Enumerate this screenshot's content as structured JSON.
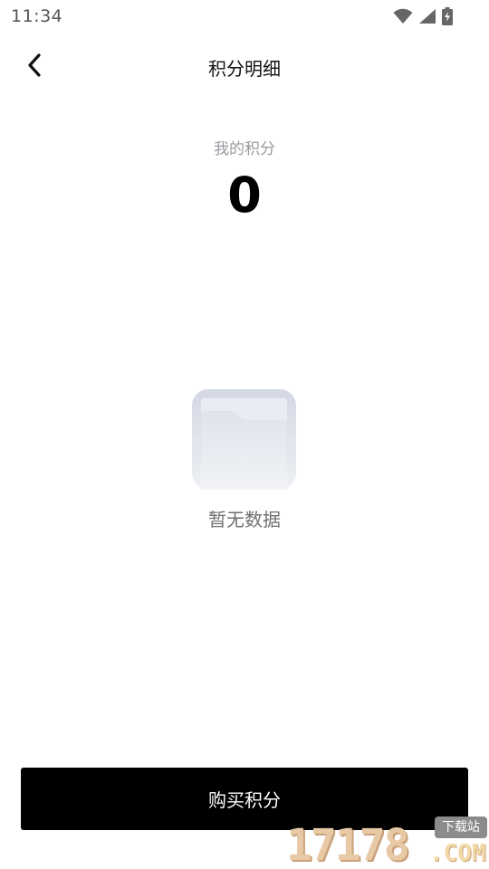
{
  "status_bar": {
    "time": "11:34",
    "icons": [
      "wifi-icon",
      "signal-icon",
      "battery-charging-icon"
    ]
  },
  "header": {
    "back_icon": "chevron-left-icon",
    "title": "积分明细"
  },
  "points": {
    "label": "我的积分",
    "value": "0"
  },
  "empty_state": {
    "icon": "folder-icon",
    "text": "暂无数据"
  },
  "footer": {
    "buy_label": "购买积分"
  },
  "watermark": {
    "digits": "17178",
    "suffix": ".COM",
    "tag": "下载站"
  },
  "colors": {
    "primary_button": "#000000",
    "secondary_text": "#9a9aa0",
    "empty_text": "#6f6f74"
  }
}
